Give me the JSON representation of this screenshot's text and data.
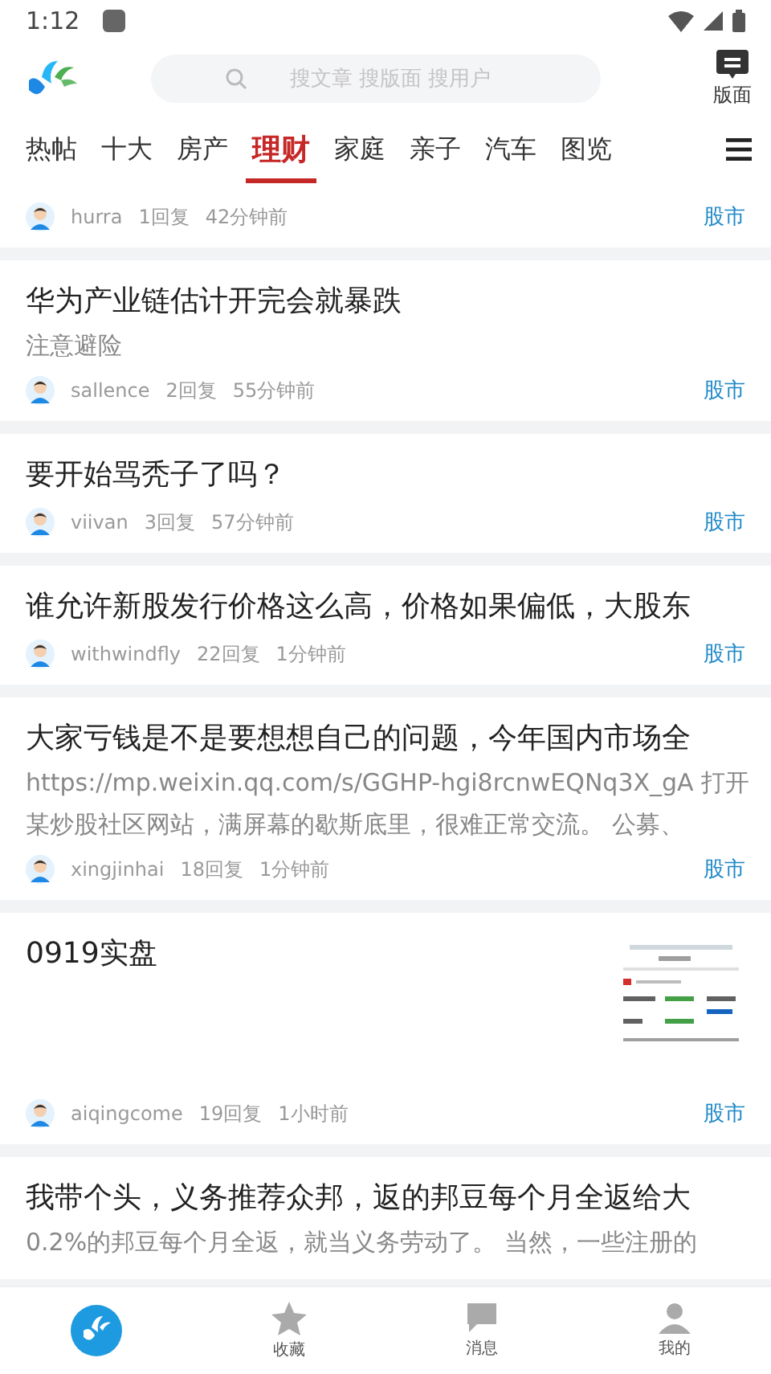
{
  "status_bar": {
    "time": "1:12"
  },
  "header": {
    "search_placeholder": "搜文章 搜版面 搜用户",
    "board_label": "版面"
  },
  "tabs": [
    {
      "label": "热帖",
      "selected": false
    },
    {
      "label": "十大",
      "selected": false
    },
    {
      "label": "房产",
      "selected": false
    },
    {
      "label": "理财",
      "selected": true
    },
    {
      "label": "家庭",
      "selected": false
    },
    {
      "label": "亲子",
      "selected": false
    },
    {
      "label": "汽车",
      "selected": false
    },
    {
      "label": "图览",
      "selected": false
    }
  ],
  "posts": [
    {
      "user": "hurra",
      "replies": "1回复",
      "time": "42分钟前",
      "board": "股市"
    },
    {
      "title": "华为产业链估计开完会就暴跌",
      "excerpt": [
        "注意避险"
      ],
      "user": "sallence",
      "replies": "2回复",
      "time": "55分钟前",
      "board": "股市"
    },
    {
      "title": "要开始骂秃子了吗？",
      "user": "viivan",
      "replies": "3回复",
      "time": "57分钟前",
      "board": "股市"
    },
    {
      "title": "谁允许新股发行价格这么高，价格如果偏低，大股东",
      "user": "withwindfly",
      "replies": "22回复",
      "time": "1分钟前",
      "board": "股市"
    },
    {
      "title": "大家亏钱是不是要想想自己的问题，今年国内市场全",
      "excerpt": [
        "https://mp.weixin.qq.com/s/GGHP-hgi8rcnwEQNq3X_gA 打开",
        "某炒股社区网站，满屏幕的歇斯底里，很难正常交流。 公募、"
      ],
      "user": "xingjinhai",
      "replies": "18回复",
      "time": "1分钟前",
      "board": "股市"
    },
    {
      "title": "0919实盘",
      "user": "aiqingcome",
      "replies": "19回复",
      "time": "1小时前",
      "board": "股市"
    },
    {
      "title": "我带个头，义务推荐众邦，返的邦豆每个月全返给大",
      "excerpt": [
        "0.2%的邦豆每个月全返，就当义务劳动了。 当然，一些注册的"
      ]
    }
  ],
  "bottom_nav": [
    {
      "kind": "home",
      "selected": true
    },
    {
      "kind": "star",
      "label": "收藏",
      "selected": false
    },
    {
      "kind": "message",
      "label": "消息",
      "selected": false
    },
    {
      "kind": "user",
      "label": "我的",
      "selected": false
    }
  ]
}
